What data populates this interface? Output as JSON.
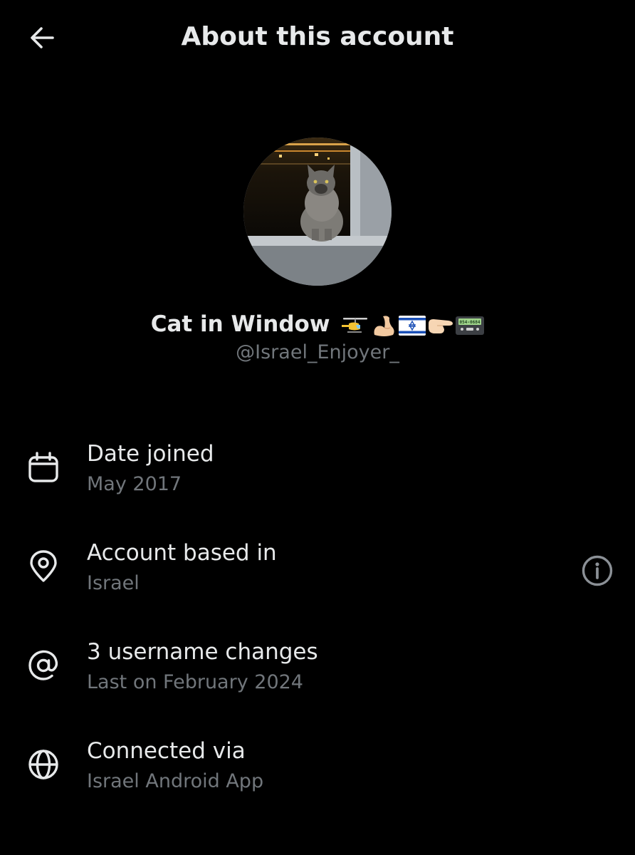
{
  "header": {
    "title": "About this account"
  },
  "profile": {
    "display_name": "Cat in Window",
    "display_name_emoji": [
      "helicopter-emoji",
      "flexed-biceps-emoji",
      "israel-flag-emoji",
      "pointing-hand-emoji",
      "pager-emoji"
    ],
    "pager_text": "054-0684",
    "handle": "@Israel_Enjoyer_"
  },
  "details": [
    {
      "icon": "calendar-icon",
      "label": "Date joined",
      "value": "May 2017"
    },
    {
      "icon": "location-pin-icon",
      "label": "Account based in",
      "value": "Israel"
    },
    {
      "icon": "at-sign-icon",
      "label": "3 username changes",
      "value": "Last on February 2024"
    },
    {
      "icon": "globe-icon",
      "label": "Connected via",
      "value": "Israel Android App"
    }
  ],
  "colors": {
    "background": "#000000",
    "primary_text": "#e7e9ea",
    "secondary_text": "#71767b"
  }
}
